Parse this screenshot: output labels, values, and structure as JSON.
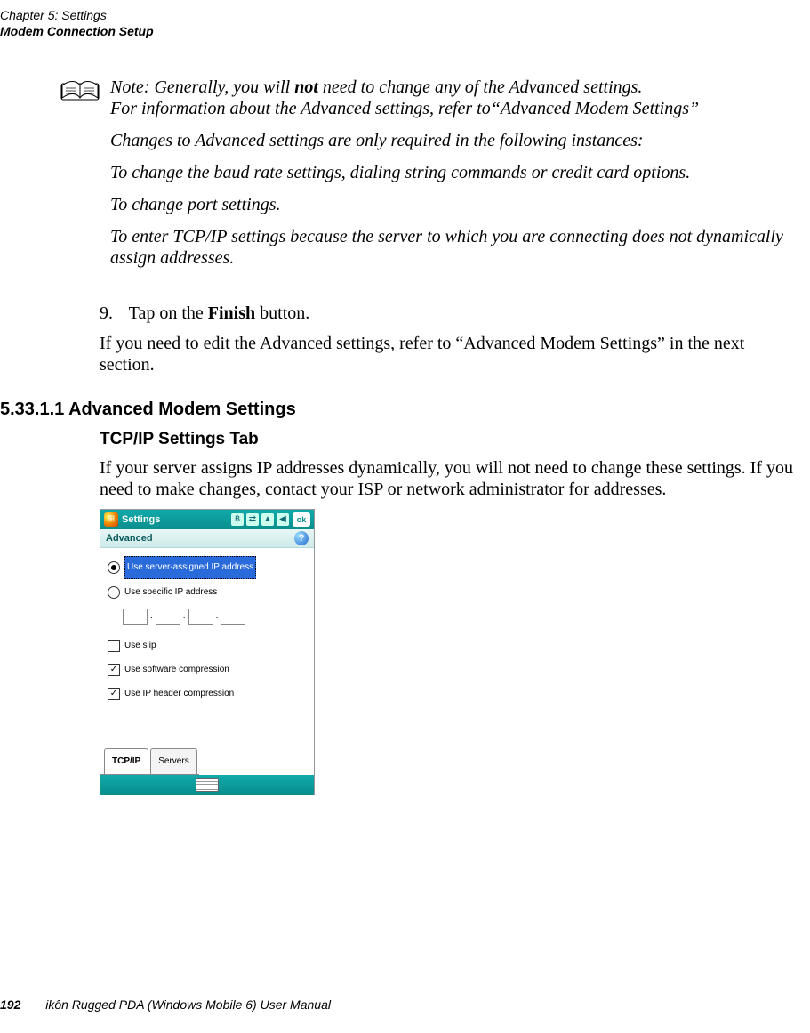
{
  "header": {
    "chapter": "Chapter 5: Settings",
    "section": "Modem Connection Setup"
  },
  "note": {
    "label": "Note:",
    "line1_a": "Generally, you will ",
    "line1_bold": "not",
    "line1_b": " need to change any of the Advanced settings.",
    "line2": "For information about the Advanced settings, refer to“Advanced Modem Settings”",
    "line3": "Changes to Advanced settings are only required in the following instances:",
    "line4": "To change the baud rate settings, dialing string commands or credit card options.",
    "line5": "To change port settings.",
    "line6": "To enter TCP/IP settings because the server to which you are connecting does not dynamically assign addresses."
  },
  "step9": {
    "num": "9.",
    "text_a": "Tap on the ",
    "text_bold": "Finish",
    "text_b": " button."
  },
  "afterStep": "If you need to edit the Advanced settings, refer to “Advanced Modem Settings” in the next section.",
  "h4": "5.33.1.1 Advanced Modem Settings",
  "h5": "TCP/IP Settings Tab",
  "tcpip_para": "If your server assigns IP addresses dynamically, you will not need to change these settings. If you need to make changes, contact your ISP or network administrator for addresses.",
  "device": {
    "titlebar": {
      "start": "⊞",
      "title": "Settings",
      "bt": "฿",
      "sync": "⇄",
      "signal": "▲",
      "vol": "◀",
      "ok": "ok"
    },
    "subbar": {
      "title": "Advanced",
      "help": "?"
    },
    "rows": {
      "r1": "Use server-assigned IP address",
      "r2": "Use specific IP address",
      "r3": "Use slip",
      "r4": "Use software compression",
      "r5": "Use IP header compression"
    },
    "tabs": {
      "t1": "TCP/IP",
      "t2": "Servers"
    }
  },
  "footer": {
    "page": "192",
    "manual": "ikôn Rugged PDA (Windows Mobile 6) User Manual"
  }
}
